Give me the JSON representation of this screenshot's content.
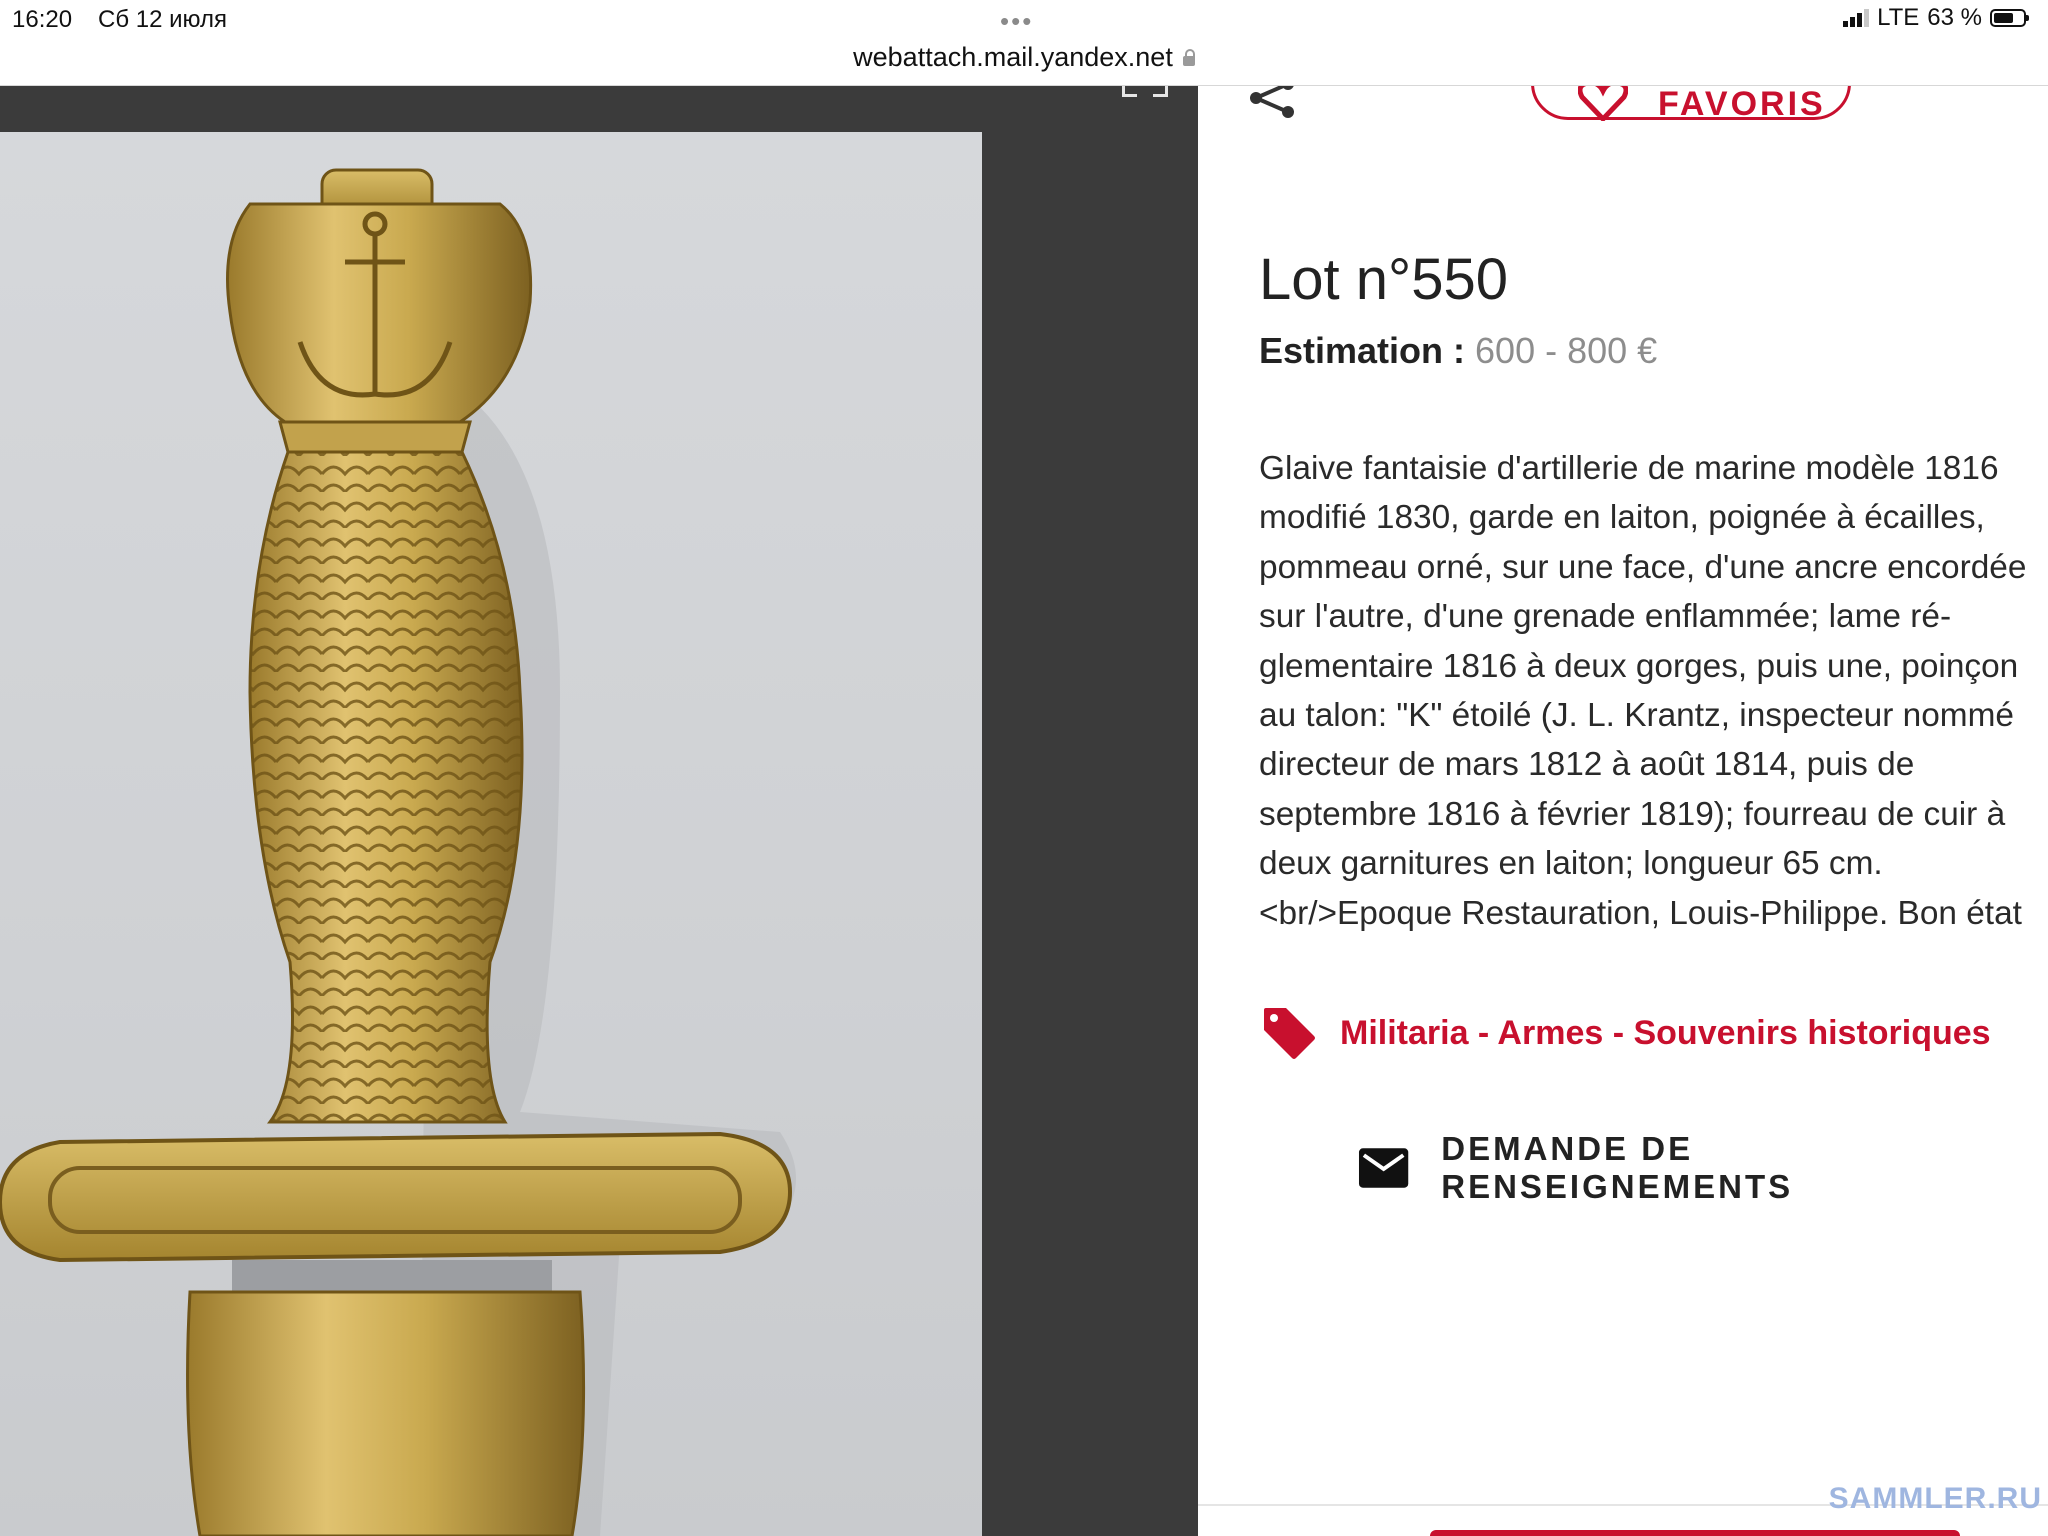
{
  "status_bar": {
    "time": "16:20",
    "date": "Сб 12 июля",
    "url": "webattach.mail.yandex.net",
    "network": "LTE",
    "battery": "63 %",
    "battery_level": 0.63
  },
  "lot": {
    "favorite_label": "FAVORIS",
    "title": "Lot n°550",
    "estimation_label": "Estimation :",
    "estimation_value": "600 - 800 €",
    "description_lines": [
      "Glaive fantaisie d'artillerie de marine modèle 1816",
      "modifié 1830, garde en laiton, poignée à écailles,",
      "pommeau orné, sur une face, d'une ancre encordée",
      "sur l'autre, d'une grenade enflammée; lame ré-",
      "glementaire 1816 à deux gorges, puis une, poinçon",
      "au talon: \"K\" étoilé (J. L. Krantz, inspecteur nommé",
      "directeur de mars 1812 à août 1814, puis de",
      "septembre 1816 à février 1819); fourreau de cuir à",
      "deux garnitures en laiton; longueur 65 cm.",
      "<br/>Epoque Restauration, Louis-Philippe. Bon état"
    ],
    "category": "Militaria - Armes - Souvenirs historiques",
    "contact_label": "DEMANDE DE RENSEIGNEMENTS"
  },
  "watermark": "SAMMLER.RU",
  "colors": {
    "accent": "#c8102e",
    "viewer_bg": "#3b3b3b",
    "brass": "#c9a94f"
  }
}
